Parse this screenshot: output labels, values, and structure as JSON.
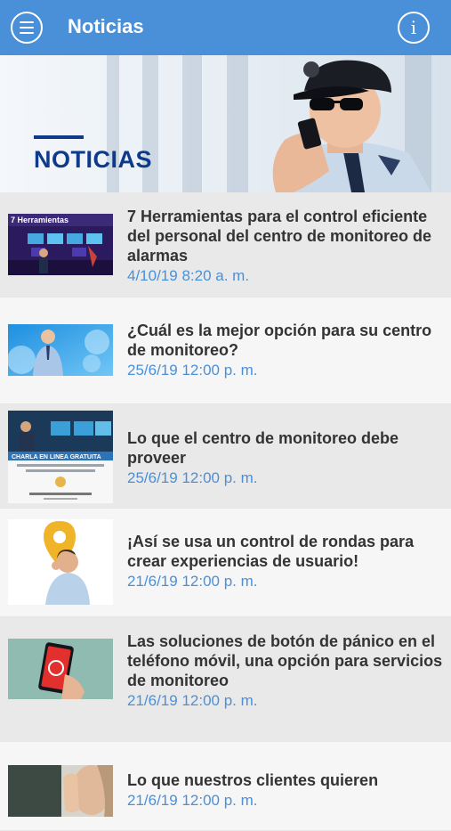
{
  "appbar": {
    "title": "Noticias",
    "menu_icon": "hamburger-icon",
    "info_icon": "info-icon",
    "info_glyph": "i",
    "color": "#4a90d9"
  },
  "hero": {
    "title": "NOTICIAS"
  },
  "thumb_texts": {
    "herramientas": "7 Herramientas",
    "charla": "CHARLA EN LINEA GRATUITA"
  },
  "news": [
    {
      "title": "7 Herramientas para el control eficiente del personal del centro de monitoreo de alarmas",
      "date": "4/10/19 8:20 a. m."
    },
    {
      "title": "¿Cuál es la mejor opción para su centro de monitoreo?",
      "date": "25/6/19 12:00 p. m."
    },
    {
      "title": "Lo que el centro de monitoreo debe proveer",
      "date": "25/6/19 12:00 p. m."
    },
    {
      "title": "¡Así se usa un control de rondas para crear experiencias de usuario!",
      "date": "21/6/19 12:00 p. m."
    },
    {
      "title": "Las soluciones de botón de pánico en el teléfono móvil, una opción para servicios de monitoreo",
      "date": "21/6/19 12:00 p. m."
    },
    {
      "title": "Lo que nuestros clientes quieren",
      "date": "21/6/19 12:00 p. m."
    }
  ]
}
